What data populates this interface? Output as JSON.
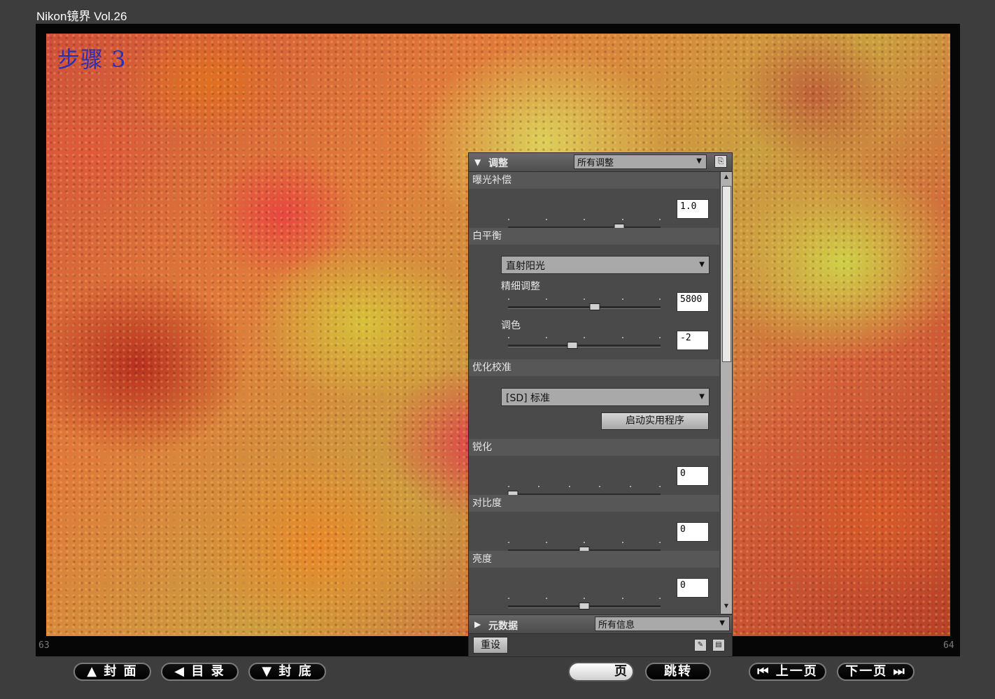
{
  "app_title": "Nikon镜界 Vol.26",
  "step_label": "步骤 3",
  "page_left": "63",
  "page_right": "64",
  "panel": {
    "header_title": "调整",
    "header_dropdown": "所有调整",
    "exposure": {
      "label": "曝光补偿",
      "value": "1.0",
      "level": 0.73
    },
    "white_balance": {
      "label": "白平衡",
      "preset": "直射阳光",
      "fine_label": "精细调整",
      "fine_value": "5800",
      "fine_level": 0.57,
      "tint_label": "调色",
      "tint_value": "-2",
      "tint_level": 0.42
    },
    "picture_control": {
      "label": "优化校准",
      "preset": "[SD] 标准",
      "launch_button": "启动实用程序"
    },
    "sharpening": {
      "label": "锐化",
      "value": "0",
      "level": 0.03
    },
    "contrast": {
      "label": "对比度",
      "value": "0",
      "level": 0.5
    },
    "brightness": {
      "label": "亮度",
      "value": "0",
      "level": 0.5
    },
    "metadata": {
      "label": "元数据",
      "dropdown": "所有信息"
    },
    "reset_button": "重设"
  },
  "nav": {
    "cover": "▲ 封  面",
    "toc": "◀ 目  录",
    "back_cover": "▼ 封  底",
    "page_input_suffix": "页",
    "jump": "跳转",
    "prev": "⏮ 上一页",
    "next": "下一页 ⏭"
  }
}
